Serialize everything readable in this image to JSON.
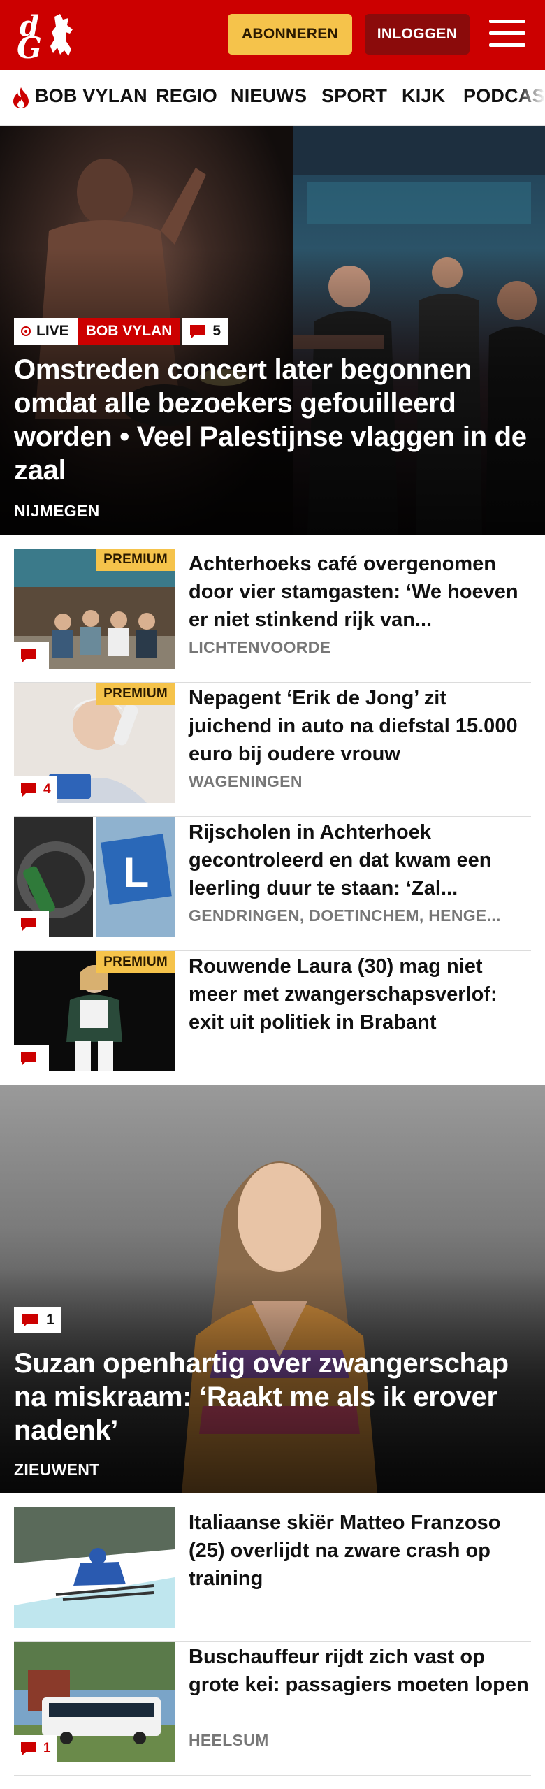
{
  "colors": {
    "brand_red": "#cc0000",
    "subscribe_yellow": "#f5c34b",
    "login_dark_red": "#8b0b0b",
    "premium_yellow": "#f5c34b",
    "location_grey": "#777777"
  },
  "header": {
    "logo_text_top": "d",
    "logo_text_bottom": "G",
    "subscribe_label": "ABONNEREN",
    "login_label": "INLOGGEN",
    "menu_icon": "hamburger-icon"
  },
  "nav": {
    "items": [
      {
        "label": "BOB VYLAN",
        "icon": "flame-icon"
      },
      {
        "label": "REGIO"
      },
      {
        "label": "NIEUWS"
      },
      {
        "label": "SPORT"
      },
      {
        "label": "KIJK"
      },
      {
        "label": "PODCAS"
      }
    ]
  },
  "hero": {
    "live_label": "LIVE",
    "tag": "BOB VYLAN",
    "comment_count": "5",
    "title": "Omstreden concert later begonnen omdat alle bezoekers gefouilleerd worden • Veel Palestijnse vlaggen in de zaal",
    "location": "NIJMEGEN"
  },
  "articles": [
    {
      "premium": "PREMIUM",
      "comment_count": "",
      "title": "Achterhoeks café overgenomen door vier stamgasten: ‘We hoeven er niet stinkend rijk van...",
      "location": "LICHTENVOORDE"
    },
    {
      "premium": "PREMIUM",
      "comment_count": "4",
      "title": "Nepagent ‘Erik de Jong’ zit juichend in auto na diefstal 15.000 euro bij oudere vrouw",
      "location": "WAGENINGEN"
    },
    {
      "premium": "",
      "comment_count": "",
      "title": "Rijscholen in Achterhoek gecontroleerd en dat kwam een leerling duur te staan: ‘Zal...",
      "location": "GENDRINGEN, DOETINCHEM, HENGE..."
    },
    {
      "premium": "PREMIUM",
      "comment_count": "",
      "title": "Rouwende Laura (30) mag niet meer met zwangerschapsverlof: exit uit politiek in Brabant",
      "location": ""
    }
  ],
  "hero2": {
    "comment_count": "1",
    "title": "Suzan openhartig over zwangerschap na miskraam: ‘Raakt me als ik erover nadenk’",
    "location": "ZIEUWENT"
  },
  "articles2": [
    {
      "comment_count": "",
      "title": "Italiaanse skiër Matteo Franzoso (25) overlijdt na zware crash op training",
      "location": ""
    },
    {
      "comment_count": "1",
      "title": "Buschauffeur rijdt zich vast op grote kei: passagiers moeten lopen",
      "location": "HEELSUM"
    }
  ]
}
